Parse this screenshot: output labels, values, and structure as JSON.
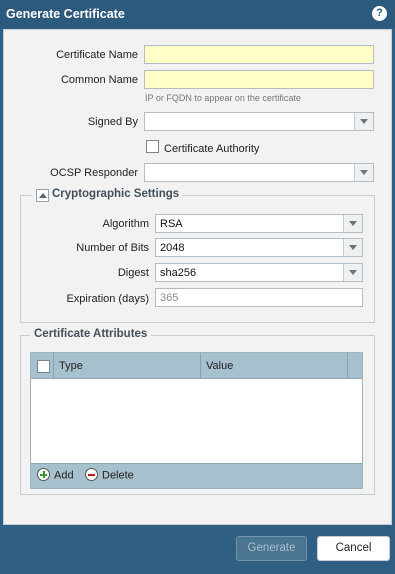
{
  "dialog": {
    "title": "Generate Certificate",
    "help_icon": "?"
  },
  "form": {
    "certificate_name": {
      "label": "Certificate Name",
      "value": ""
    },
    "common_name": {
      "label": "Common Name",
      "value": "",
      "hint": "IP or FQDN to appear on the certificate"
    },
    "signed_by": {
      "label": "Signed By",
      "value": ""
    },
    "certificate_authority": {
      "label": "Certificate Authority",
      "checked": false
    },
    "ocsp_responder": {
      "label": "OCSP Responder",
      "value": ""
    }
  },
  "crypto": {
    "legend": "Cryptographic Settings",
    "algorithm": {
      "label": "Algorithm",
      "value": "RSA"
    },
    "number_of_bits": {
      "label": "Number of Bits",
      "value": "2048"
    },
    "digest": {
      "label": "Digest",
      "value": "sha256"
    },
    "expiration": {
      "label": "Expiration (days)",
      "value": "365"
    }
  },
  "attributes": {
    "legend": "Certificate Attributes",
    "columns": [
      "Type",
      "Value"
    ],
    "rows": [],
    "add_label": "Add",
    "delete_label": "Delete"
  },
  "buttons": {
    "generate": "Generate",
    "cancel": "Cancel"
  },
  "colors": {
    "titlebar": "#2c5a7c",
    "required_field": "#ffffc6",
    "grid_header": "#a6c0cd"
  }
}
